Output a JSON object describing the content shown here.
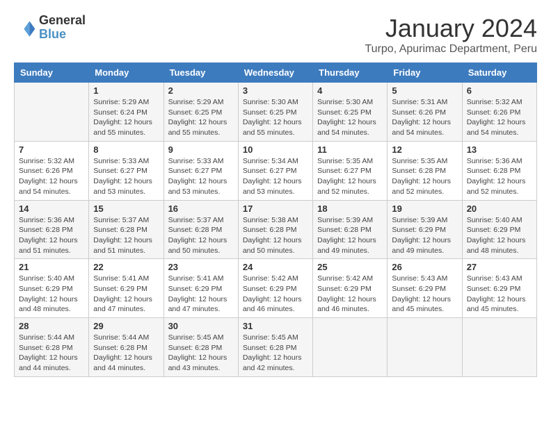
{
  "logo": {
    "line1": "General",
    "line2": "Blue"
  },
  "title": "January 2024",
  "location": "Turpo, Apurimac Department, Peru",
  "days_of_week": [
    "Sunday",
    "Monday",
    "Tuesday",
    "Wednesday",
    "Thursday",
    "Friday",
    "Saturday"
  ],
  "weeks": [
    [
      {
        "day": "",
        "info": ""
      },
      {
        "day": "1",
        "info": "Sunrise: 5:29 AM\nSunset: 6:24 PM\nDaylight: 12 hours\nand 55 minutes."
      },
      {
        "day": "2",
        "info": "Sunrise: 5:29 AM\nSunset: 6:25 PM\nDaylight: 12 hours\nand 55 minutes."
      },
      {
        "day": "3",
        "info": "Sunrise: 5:30 AM\nSunset: 6:25 PM\nDaylight: 12 hours\nand 55 minutes."
      },
      {
        "day": "4",
        "info": "Sunrise: 5:30 AM\nSunset: 6:25 PM\nDaylight: 12 hours\nand 54 minutes."
      },
      {
        "day": "5",
        "info": "Sunrise: 5:31 AM\nSunset: 6:26 PM\nDaylight: 12 hours\nand 54 minutes."
      },
      {
        "day": "6",
        "info": "Sunrise: 5:32 AM\nSunset: 6:26 PM\nDaylight: 12 hours\nand 54 minutes."
      }
    ],
    [
      {
        "day": "7",
        "info": "Sunrise: 5:32 AM\nSunset: 6:26 PM\nDaylight: 12 hours\nand 54 minutes."
      },
      {
        "day": "8",
        "info": "Sunrise: 5:33 AM\nSunset: 6:27 PM\nDaylight: 12 hours\nand 53 minutes."
      },
      {
        "day": "9",
        "info": "Sunrise: 5:33 AM\nSunset: 6:27 PM\nDaylight: 12 hours\nand 53 minutes."
      },
      {
        "day": "10",
        "info": "Sunrise: 5:34 AM\nSunset: 6:27 PM\nDaylight: 12 hours\nand 53 minutes."
      },
      {
        "day": "11",
        "info": "Sunrise: 5:35 AM\nSunset: 6:27 PM\nDaylight: 12 hours\nand 52 minutes."
      },
      {
        "day": "12",
        "info": "Sunrise: 5:35 AM\nSunset: 6:28 PM\nDaylight: 12 hours\nand 52 minutes."
      },
      {
        "day": "13",
        "info": "Sunrise: 5:36 AM\nSunset: 6:28 PM\nDaylight: 12 hours\nand 52 minutes."
      }
    ],
    [
      {
        "day": "14",
        "info": "Sunrise: 5:36 AM\nSunset: 6:28 PM\nDaylight: 12 hours\nand 51 minutes."
      },
      {
        "day": "15",
        "info": "Sunrise: 5:37 AM\nSunset: 6:28 PM\nDaylight: 12 hours\nand 51 minutes."
      },
      {
        "day": "16",
        "info": "Sunrise: 5:37 AM\nSunset: 6:28 PM\nDaylight: 12 hours\nand 50 minutes."
      },
      {
        "day": "17",
        "info": "Sunrise: 5:38 AM\nSunset: 6:28 PM\nDaylight: 12 hours\nand 50 minutes."
      },
      {
        "day": "18",
        "info": "Sunrise: 5:39 AM\nSunset: 6:28 PM\nDaylight: 12 hours\nand 49 minutes."
      },
      {
        "day": "19",
        "info": "Sunrise: 5:39 AM\nSunset: 6:29 PM\nDaylight: 12 hours\nand 49 minutes."
      },
      {
        "day": "20",
        "info": "Sunrise: 5:40 AM\nSunset: 6:29 PM\nDaylight: 12 hours\nand 48 minutes."
      }
    ],
    [
      {
        "day": "21",
        "info": "Sunrise: 5:40 AM\nSunset: 6:29 PM\nDaylight: 12 hours\nand 48 minutes."
      },
      {
        "day": "22",
        "info": "Sunrise: 5:41 AM\nSunset: 6:29 PM\nDaylight: 12 hours\nand 47 minutes."
      },
      {
        "day": "23",
        "info": "Sunrise: 5:41 AM\nSunset: 6:29 PM\nDaylight: 12 hours\nand 47 minutes."
      },
      {
        "day": "24",
        "info": "Sunrise: 5:42 AM\nSunset: 6:29 PM\nDaylight: 12 hours\nand 46 minutes."
      },
      {
        "day": "25",
        "info": "Sunrise: 5:42 AM\nSunset: 6:29 PM\nDaylight: 12 hours\nand 46 minutes."
      },
      {
        "day": "26",
        "info": "Sunrise: 5:43 AM\nSunset: 6:29 PM\nDaylight: 12 hours\nand 45 minutes."
      },
      {
        "day": "27",
        "info": "Sunrise: 5:43 AM\nSunset: 6:29 PM\nDaylight: 12 hours\nand 45 minutes."
      }
    ],
    [
      {
        "day": "28",
        "info": "Sunrise: 5:44 AM\nSunset: 6:28 PM\nDaylight: 12 hours\nand 44 minutes."
      },
      {
        "day": "29",
        "info": "Sunrise: 5:44 AM\nSunset: 6:28 PM\nDaylight: 12 hours\nand 44 minutes."
      },
      {
        "day": "30",
        "info": "Sunrise: 5:45 AM\nSunset: 6:28 PM\nDaylight: 12 hours\nand 43 minutes."
      },
      {
        "day": "31",
        "info": "Sunrise: 5:45 AM\nSunset: 6:28 PM\nDaylight: 12 hours\nand 42 minutes."
      },
      {
        "day": "",
        "info": ""
      },
      {
        "day": "",
        "info": ""
      },
      {
        "day": "",
        "info": ""
      }
    ]
  ]
}
